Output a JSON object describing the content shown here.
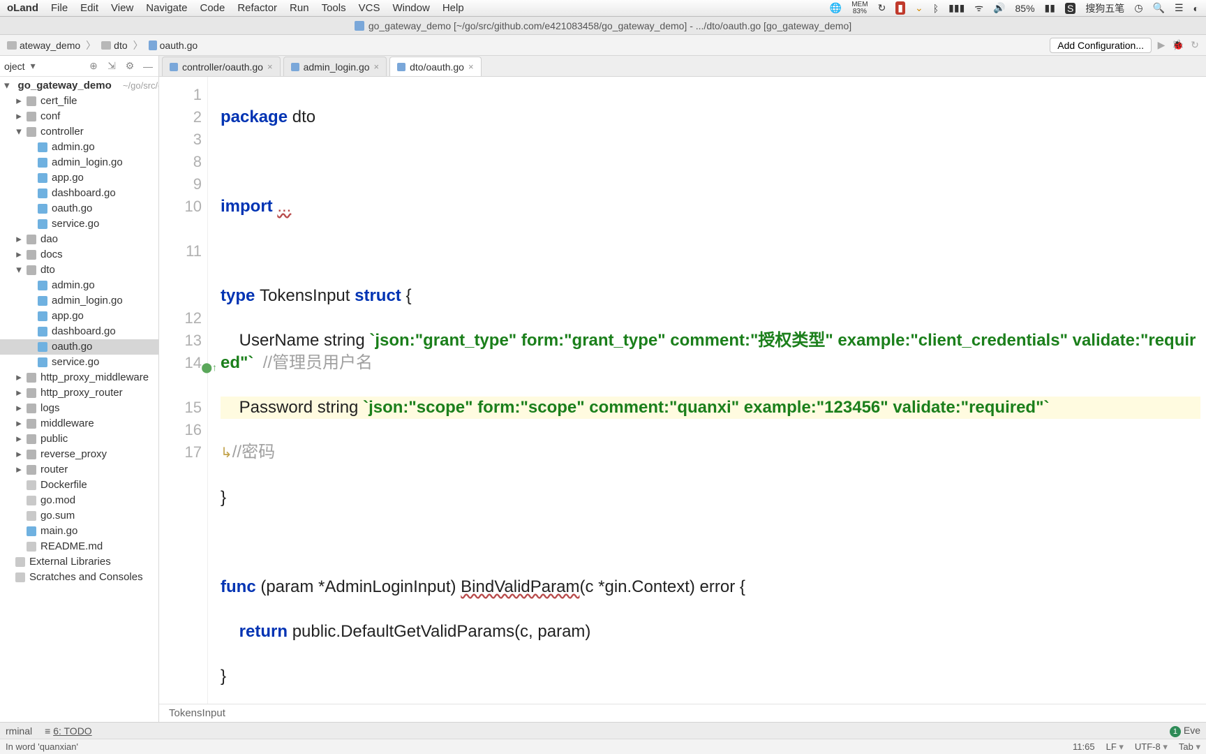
{
  "menubar": {
    "app": "oLand",
    "items": [
      "File",
      "Edit",
      "View",
      "Navigate",
      "Code",
      "Refactor",
      "Run",
      "Tools",
      "VCS",
      "Window",
      "Help"
    ],
    "mem_label": "MEM",
    "mem_pct": "83%",
    "battery": "85%",
    "ime": "搜狗五笔"
  },
  "window_title": "go_gateway_demo [~/go/src/github.com/e421083458/go_gateway_demo] - .../dto/oauth.go [go_gateway_demo]",
  "breadcrumb": {
    "items": [
      "ateway_demo",
      "dto",
      "oauth.go"
    ]
  },
  "toolbar": {
    "add_config": "Add Configuration..."
  },
  "sidebar": {
    "header_title": "oject",
    "root": "go_gateway_demo",
    "root_path": "~/go/src/g",
    "tree": [
      {
        "t": "dir",
        "l": "cert_file",
        "i": 1
      },
      {
        "t": "dir",
        "l": "conf",
        "i": 1
      },
      {
        "t": "dir",
        "l": "controller",
        "i": 1,
        "open": true
      },
      {
        "t": "go",
        "l": "admin.go",
        "i": 2
      },
      {
        "t": "go",
        "l": "admin_login.go",
        "i": 2
      },
      {
        "t": "go",
        "l": "app.go",
        "i": 2
      },
      {
        "t": "go",
        "l": "dashboard.go",
        "i": 2
      },
      {
        "t": "go",
        "l": "oauth.go",
        "i": 2
      },
      {
        "t": "go",
        "l": "service.go",
        "i": 2
      },
      {
        "t": "dir",
        "l": "dao",
        "i": 1
      },
      {
        "t": "dir",
        "l": "docs",
        "i": 1
      },
      {
        "t": "dir",
        "l": "dto",
        "i": 1,
        "open": true
      },
      {
        "t": "go",
        "l": "admin.go",
        "i": 2
      },
      {
        "t": "go",
        "l": "admin_login.go",
        "i": 2
      },
      {
        "t": "go",
        "l": "app.go",
        "i": 2
      },
      {
        "t": "go",
        "l": "dashboard.go",
        "i": 2
      },
      {
        "t": "go",
        "l": "oauth.go",
        "i": 2,
        "sel": true
      },
      {
        "t": "go",
        "l": "service.go",
        "i": 2
      },
      {
        "t": "dir",
        "l": "http_proxy_middleware",
        "i": 1
      },
      {
        "t": "dir",
        "l": "http_proxy_router",
        "i": 1
      },
      {
        "t": "dir",
        "l": "logs",
        "i": 1
      },
      {
        "t": "dir",
        "l": "middleware",
        "i": 1
      },
      {
        "t": "dir",
        "l": "public",
        "i": 1
      },
      {
        "t": "dir",
        "l": "reverse_proxy",
        "i": 1
      },
      {
        "t": "dir",
        "l": "router",
        "i": 1
      },
      {
        "t": "txt",
        "l": "Dockerfile",
        "i": 1
      },
      {
        "t": "txt",
        "l": "go.mod",
        "i": 1
      },
      {
        "t": "txt",
        "l": "go.sum",
        "i": 1
      },
      {
        "t": "go",
        "l": "main.go",
        "i": 1
      },
      {
        "t": "txt",
        "l": "README.md",
        "i": 1
      },
      {
        "t": "lib",
        "l": "External Libraries",
        "i": 0
      },
      {
        "t": "lib",
        "l": "Scratches and Consoles",
        "i": 0
      }
    ]
  },
  "tabs": [
    {
      "label": "controller/oauth.go",
      "active": false
    },
    {
      "label": "admin_login.go",
      "active": false
    },
    {
      "label": "dto/oauth.go",
      "active": true
    }
  ],
  "code_lines": [
    "1",
    "2",
    "3",
    "8",
    "9",
    "10",
    "",
    "11",
    "",
    "",
    "12",
    "13",
    "14",
    "",
    "15",
    "16",
    "17"
  ],
  "code": {
    "l1_pkg": "package ",
    "l1_name": "dto",
    "l3_imp": "import ",
    "l3_fold": "...",
    "l9_a": "type ",
    "l9_b": "TokensInput ",
    "l9_c": "struct ",
    "l9_d": "{",
    "l10_a": "    UserName string ",
    "l10_tag": "`json:\"grant_type\" form:\"grant_type\" comment:\"授权类型\" example:\"client_credentials\" validate:\"required\"`",
    "l10_cm": "  //管理员用户名",
    "l11_a": "    Password string ",
    "l11_tag": "`json:\"scope\" form:\"scope\" comment:\"quanxi",
    "l11_tag2": "\" example:\"123456\" validate:\"required\"`",
    "l11_cm": "//密码",
    "l12": "}",
    "l14_a": "func ",
    "l14_b": "(param *AdminLoginInput) ",
    "l14_c": "BindValidParam",
    "l14_d": "(c *gin.Context) error {",
    "l15_a": "    ",
    "l15_b": "return ",
    "l15_c": "public.DefaultGetValidParams(c, param)",
    "l16": "}"
  },
  "bottom_breadcrumb": "TokensInput",
  "bottom_tools": {
    "terminal": "rminal",
    "todo": "6: TODO",
    "event": "Eve"
  },
  "status": {
    "msg": "In word 'quanxian'",
    "pos": "11:65",
    "le": "LF",
    "enc": "UTF-8",
    "tab": "Tab"
  }
}
